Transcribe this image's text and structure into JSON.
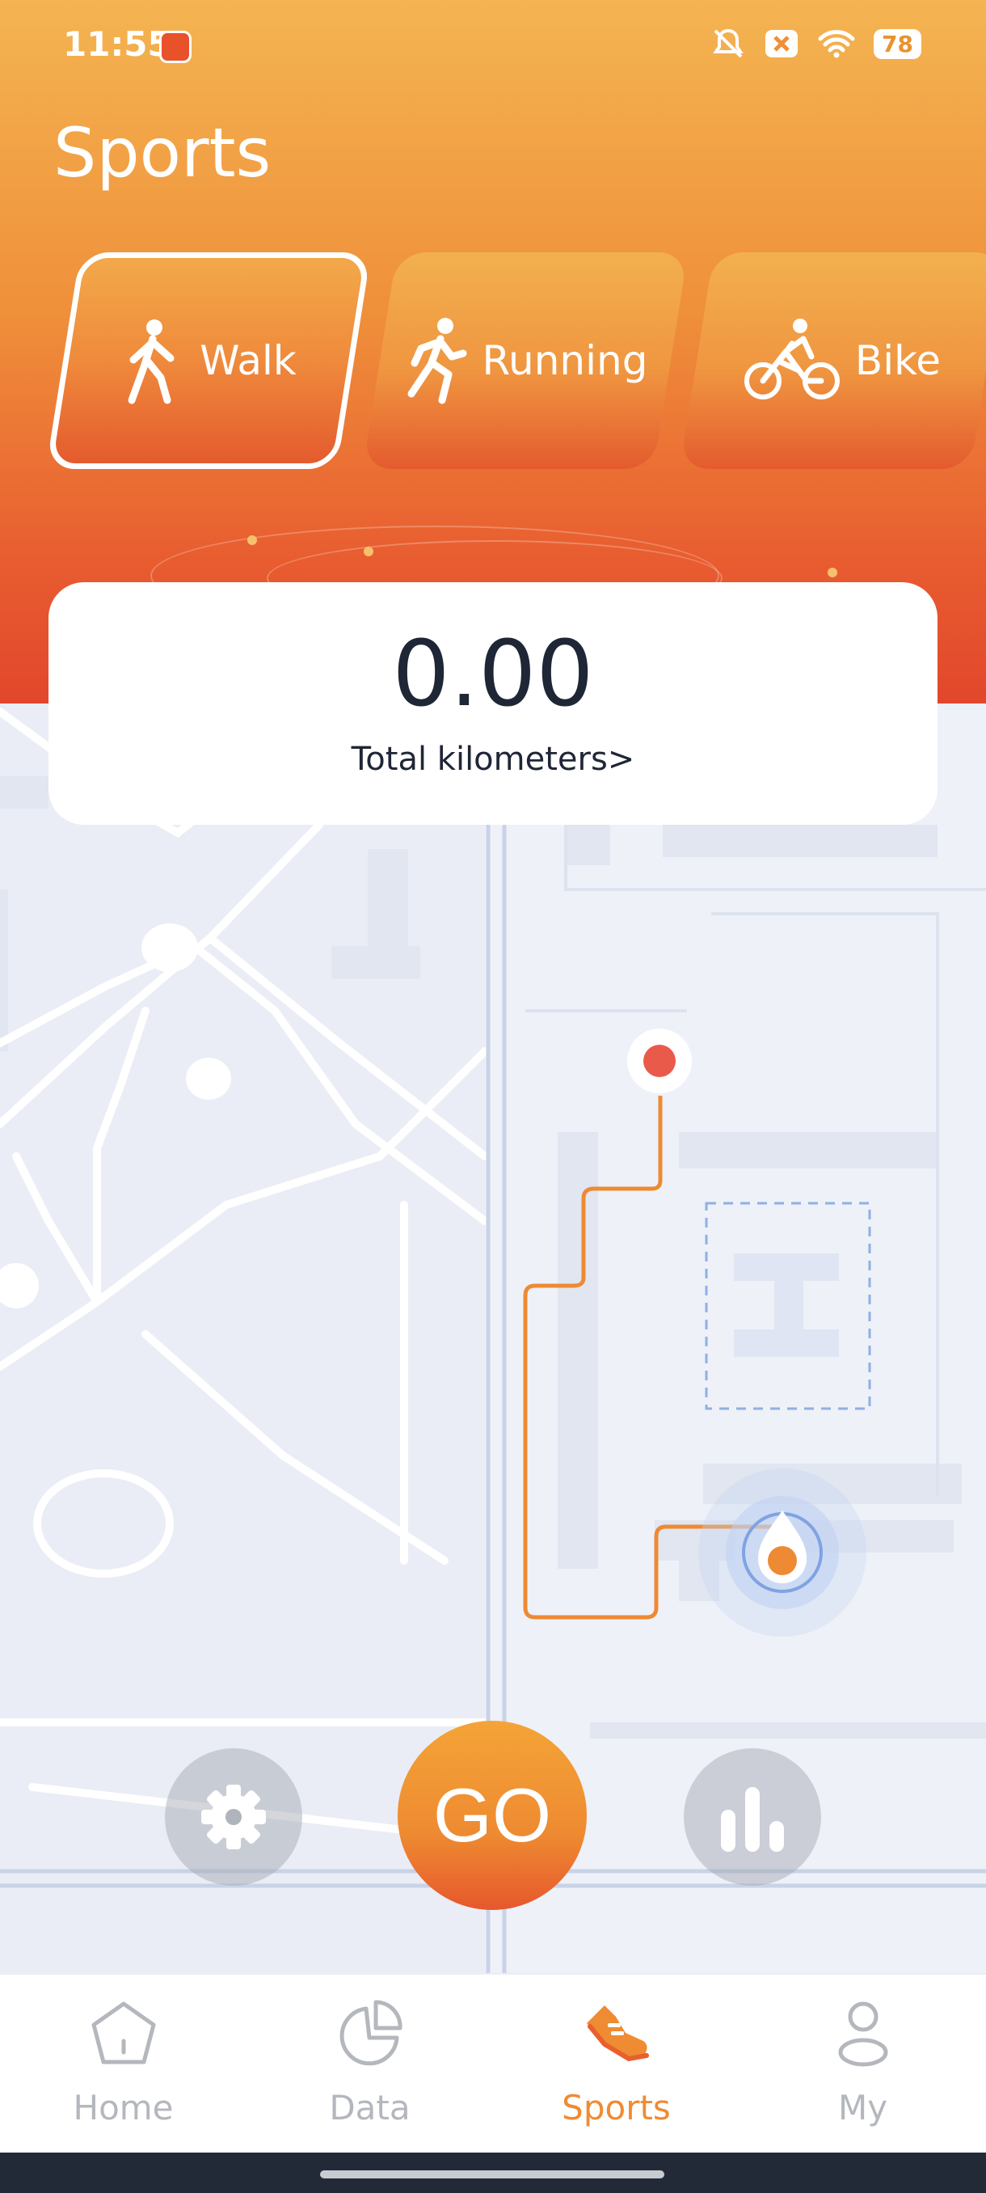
{
  "status": {
    "time": "11:55",
    "battery": "78"
  },
  "page_title": "Sports",
  "modes": [
    {
      "label": "Walk",
      "icon": "walk-icon",
      "active": true
    },
    {
      "label": "Running",
      "icon": "running-icon",
      "active": false
    },
    {
      "label": "Bike",
      "icon": "bike-icon",
      "active": false
    }
  ],
  "summary": {
    "value": "0.00",
    "label": "Total kilometers>"
  },
  "actions": {
    "go_label": "GO",
    "left_icon": "settings-icon",
    "right_icon": "stats-icon"
  },
  "nav": [
    {
      "label": "Home",
      "icon": "home-icon"
    },
    {
      "label": "Data",
      "icon": "pie-chart-icon"
    },
    {
      "label": "Sports",
      "icon": "sneaker-icon",
      "active": true
    },
    {
      "label": "My",
      "icon": "person-icon"
    }
  ],
  "colors": {
    "accent": "#ef8b33",
    "header_top": "#f4b451",
    "header_bottom": "#e2472c",
    "inactive": "#b4b7bd"
  }
}
